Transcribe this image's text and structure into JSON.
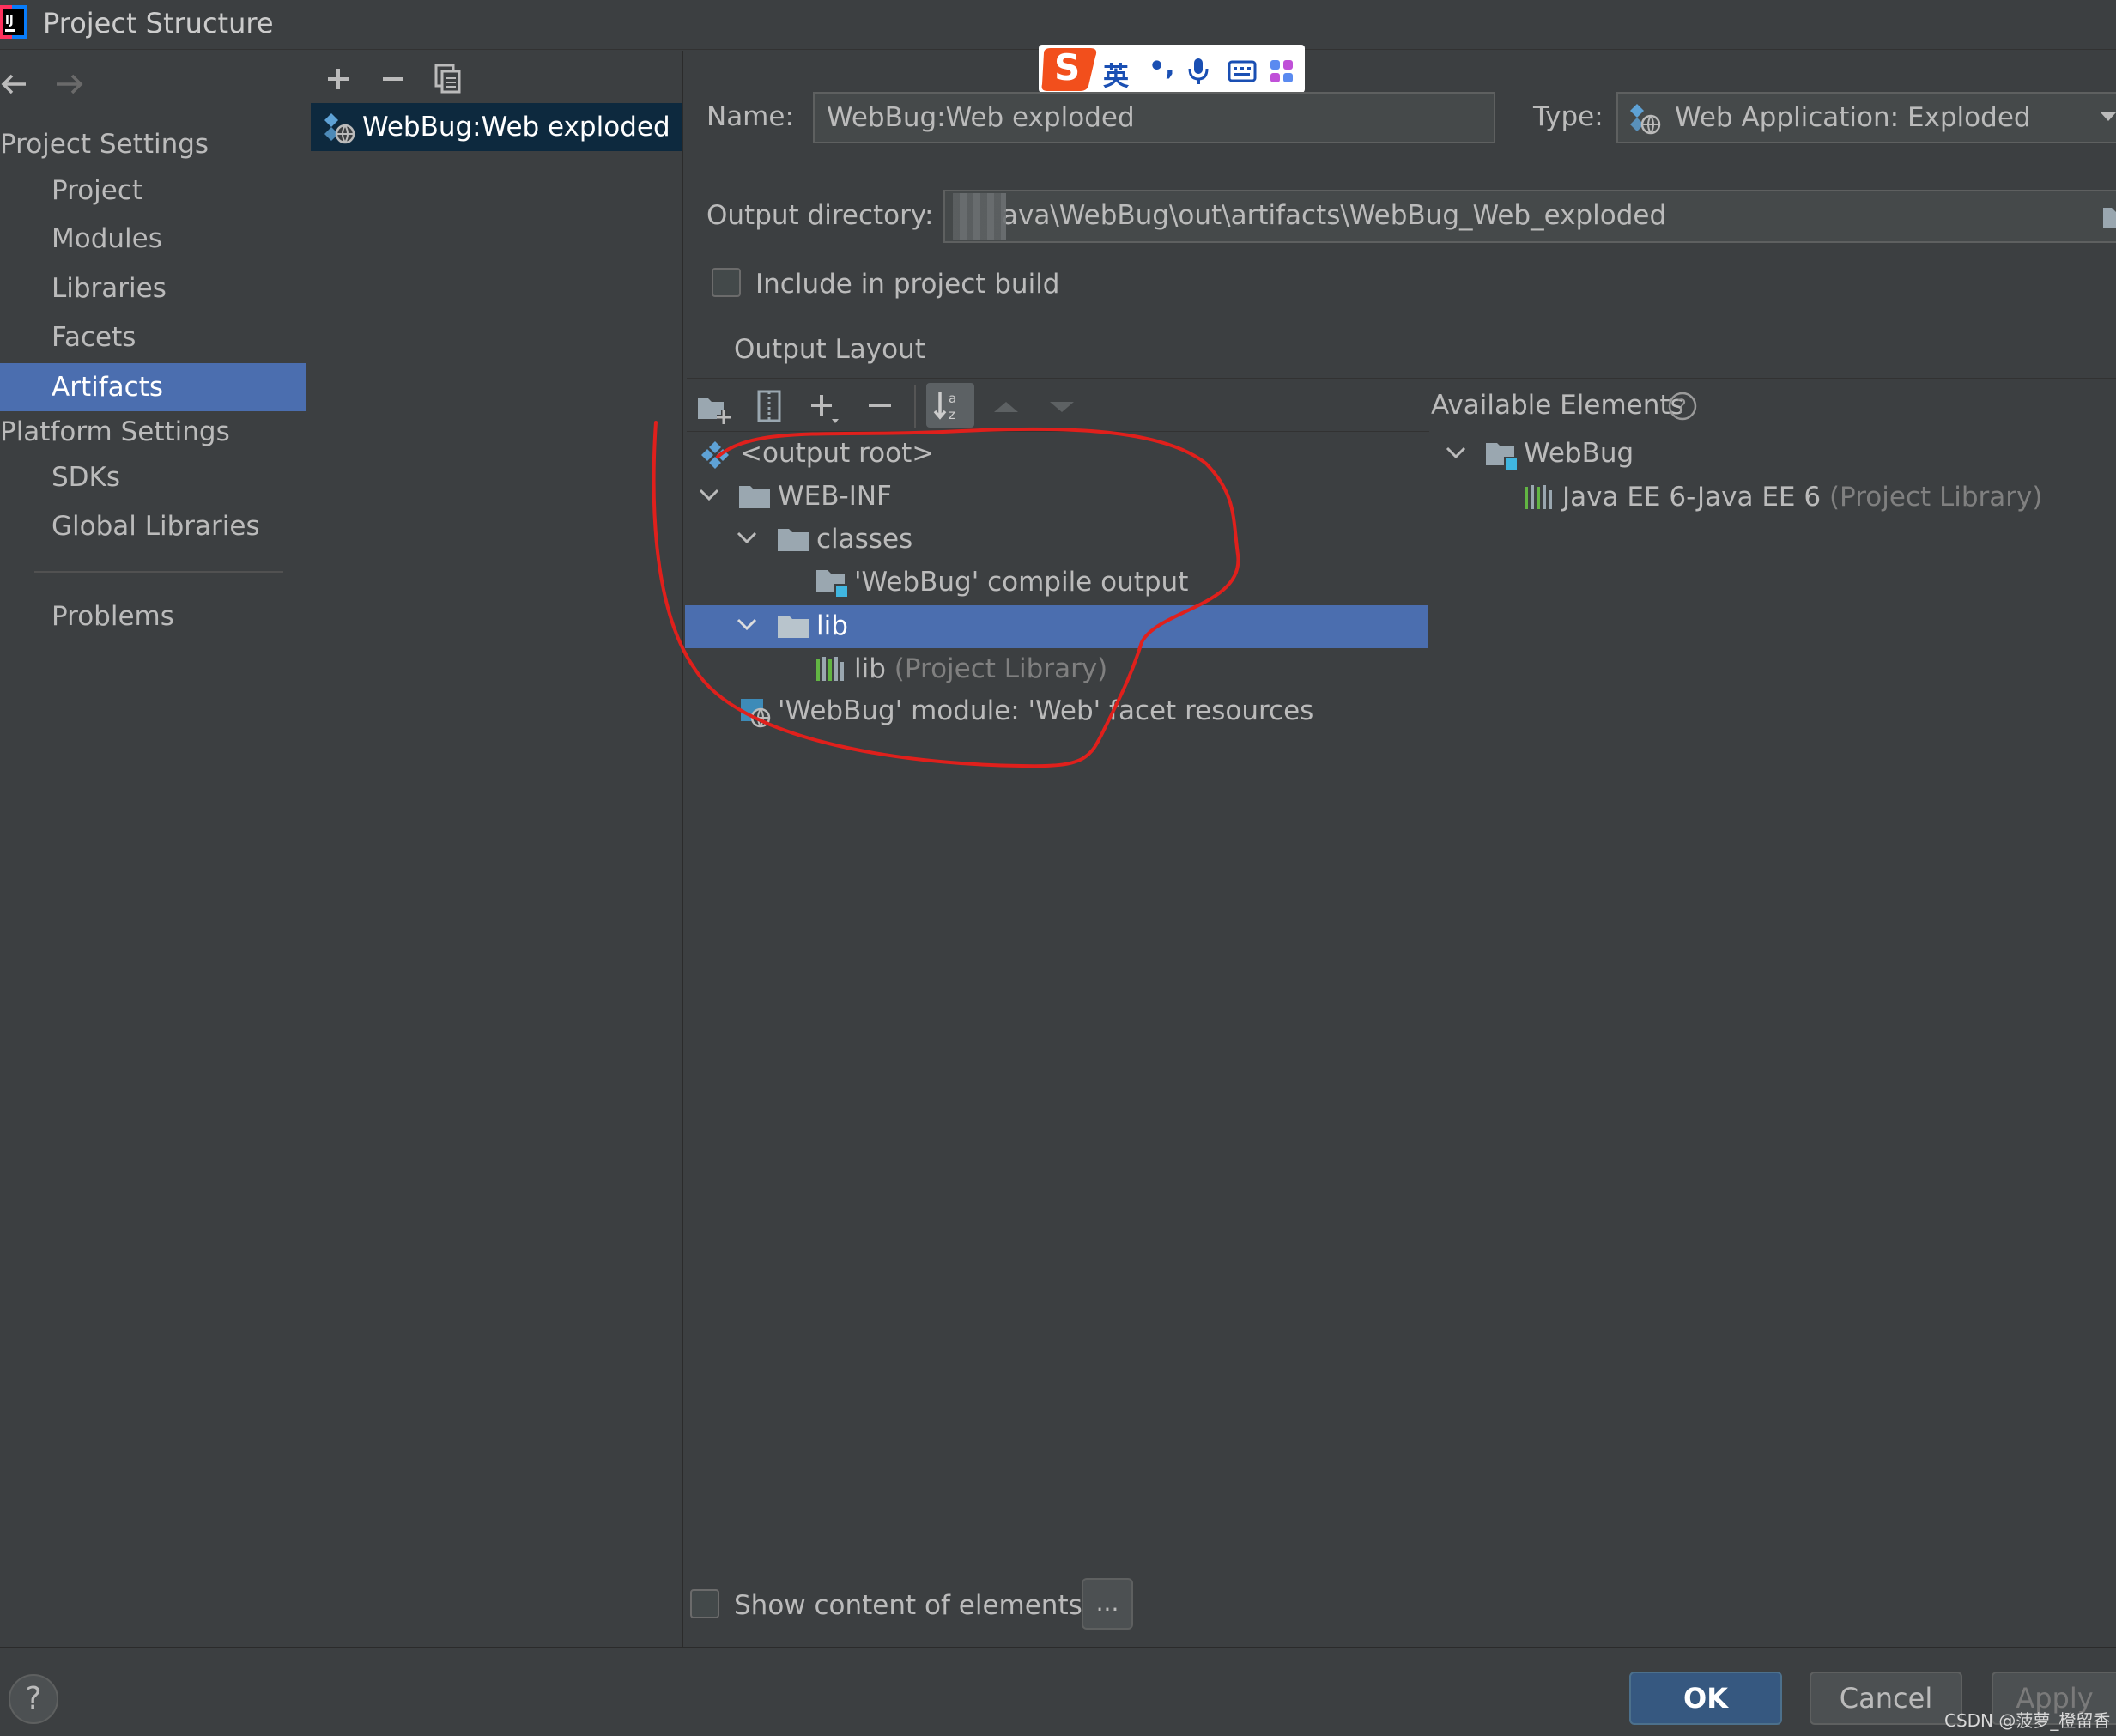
{
  "window": {
    "title": "Project Structure"
  },
  "nav": {
    "back_icon": "arrow-left-icon",
    "forward_icon": "arrow-right-icon",
    "project_settings_header": "Project Settings",
    "project_settings_items": [
      "Project",
      "Modules",
      "Libraries",
      "Facets",
      "Artifacts"
    ],
    "selected_item": "Artifacts",
    "platform_settings_header": "Platform Settings",
    "platform_settings_items": [
      "SDKs",
      "Global Libraries"
    ],
    "problems": "Problems"
  },
  "artifacts": {
    "toolbar_icons": [
      "plus-icon",
      "minus-icon",
      "copy-icon"
    ],
    "items": [
      {
        "label": "WebBug:Web exploded",
        "icon": "web-exploded-icon"
      }
    ]
  },
  "form": {
    "name_label": "Name:",
    "name_value": "WebBug:Web exploded",
    "type_label": "Type:",
    "type_value": "Web Application: Exploded",
    "output_dir_label": "Output directory:",
    "output_dir_value": "ava\\WebBug\\out\\artifacts\\WebBug_Web_exploded",
    "include_build_label": "Include in project build",
    "include_build_checked": false,
    "output_layout_tab": "Output Layout"
  },
  "layout_toolbar": {
    "icons": [
      "new-directory-icon",
      "archive-icon",
      "add-copy-icon",
      "remove-icon",
      "sort-icon",
      "move-up-icon",
      "move-down-icon"
    ]
  },
  "layout_tree": [
    {
      "label": "<output root>",
      "suffix": "",
      "icon": "output-root-icon"
    },
    {
      "label": "WEB-INF",
      "suffix": "",
      "icon": "folder-icon",
      "expanded": true
    },
    {
      "label": "classes",
      "suffix": "",
      "icon": "folder-icon",
      "expanded": true
    },
    {
      "label": "'WebBug' compile output",
      "suffix": "",
      "icon": "module-output-icon"
    },
    {
      "label": "lib",
      "suffix": "",
      "icon": "folder-icon",
      "expanded": true,
      "selected": true
    },
    {
      "label": "lib",
      "suffix": "(Project Library)",
      "icon": "library-icon"
    },
    {
      "label": "'WebBug' module: 'Web' facet resources",
      "suffix": "",
      "icon": "web-facet-icon"
    }
  ],
  "available": {
    "header": "Available Elements",
    "help_icon": "help-circle-icon",
    "tree": [
      {
        "label": "WebBug",
        "suffix": "",
        "icon": "module-folder-icon",
        "expanded": true
      },
      {
        "label": "Java EE 6-Java EE 6",
        "suffix": "(Project Library)",
        "icon": "library-icon"
      }
    ]
  },
  "show_content": {
    "label": "Show content of elements",
    "checked": false,
    "more_button": "..."
  },
  "buttons": {
    "help": "?",
    "ok": "OK",
    "cancel": "Cancel",
    "apply": "Apply"
  },
  "ime_toolbar": {
    "logo": "S",
    "language": "英",
    "punctuation": "•,",
    "icons": [
      "microphone-icon",
      "keyboard-icon",
      "apps-grid-icon"
    ]
  },
  "watermark": "CSDN @菠萝_橙留香",
  "colors": {
    "background": "#3c3f41",
    "selection": "#4b6eaf",
    "list_selection": "#0d293e",
    "annotation": "#e0201c",
    "default_button": "#365880"
  }
}
